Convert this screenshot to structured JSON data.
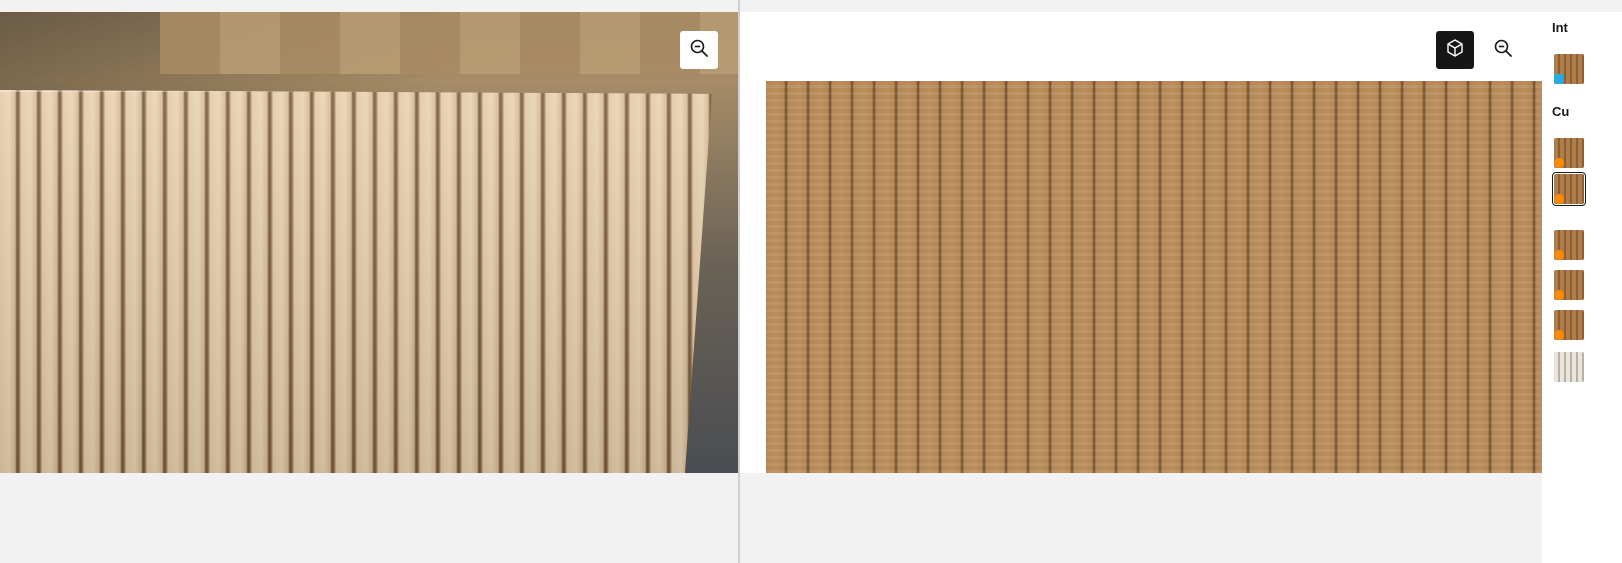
{
  "left_pane": {
    "zoom_button": {
      "icon": "zoom-out-icon"
    }
  },
  "right_pane": {
    "view_3d_button": {
      "icon": "cube-icon"
    },
    "zoom_button": {
      "icon": "zoom-out-icon"
    }
  },
  "side_panel": {
    "sections": [
      {
        "title": "Int",
        "thumb_count": 1
      },
      {
        "title": "Cu",
        "thumb_count": 6
      }
    ]
  },
  "colors": {
    "accent_dark": "#161616",
    "badge_orange": "#ff8a00",
    "badge_blue": "#2aa8e0",
    "background": "#f2f2f2"
  }
}
